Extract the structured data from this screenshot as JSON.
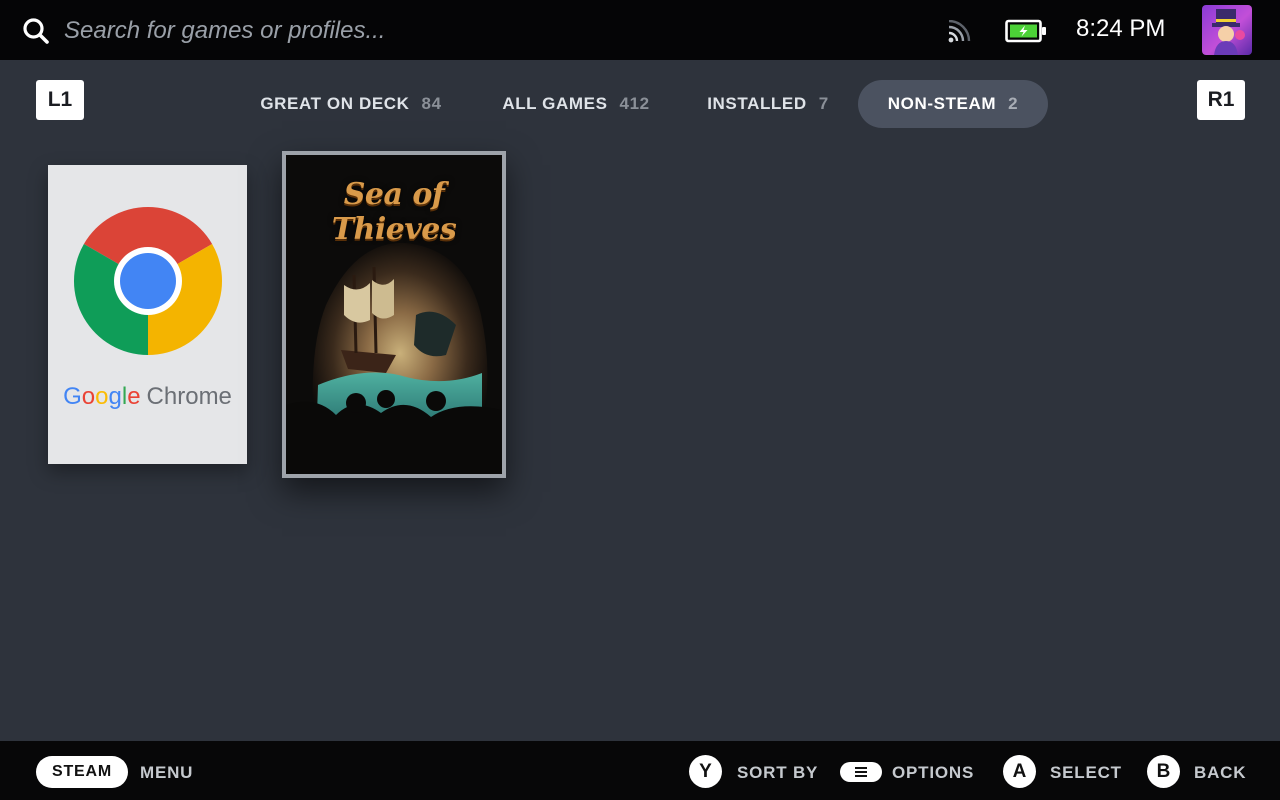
{
  "topbar": {
    "search_placeholder": "Search for games or profiles...",
    "clock": "8:24 PM"
  },
  "shoulders": {
    "left": "L1",
    "right": "R1"
  },
  "tabs": [
    {
      "label": "GREAT ON DECK",
      "count": "84",
      "active": false
    },
    {
      "label": "ALL GAMES",
      "count": "412",
      "active": false
    },
    {
      "label": "INSTALLED",
      "count": "7",
      "active": false
    },
    {
      "label": "NON-STEAM",
      "count": "2",
      "active": true
    }
  ],
  "games": [
    {
      "name": "Google Chrome",
      "logo_letters": [
        "G",
        "o",
        "o",
        "g",
        "l",
        "e"
      ],
      "word": "Chrome",
      "selected": false
    },
    {
      "name": "Sea of Thieves",
      "logo_text": "Sea of Thieves",
      "selected": true
    }
  ],
  "bottombar": {
    "steam": "STEAM",
    "menu": "MENU",
    "y_button": "Y",
    "sort_by": "SORT BY",
    "options": "OPTIONS",
    "a_button": "A",
    "select": "SELECT",
    "b_button": "B",
    "back": "BACK"
  },
  "colors": {
    "background": "#2e333c",
    "topbar": "#050506",
    "active_tab": "#4b5260",
    "battery_green": "#4cd137"
  },
  "icons": {
    "search": "search-icon",
    "cast": "cast-icon",
    "battery": "battery-charging-icon",
    "avatar": "avatar",
    "options": "menu-lines-icon"
  }
}
